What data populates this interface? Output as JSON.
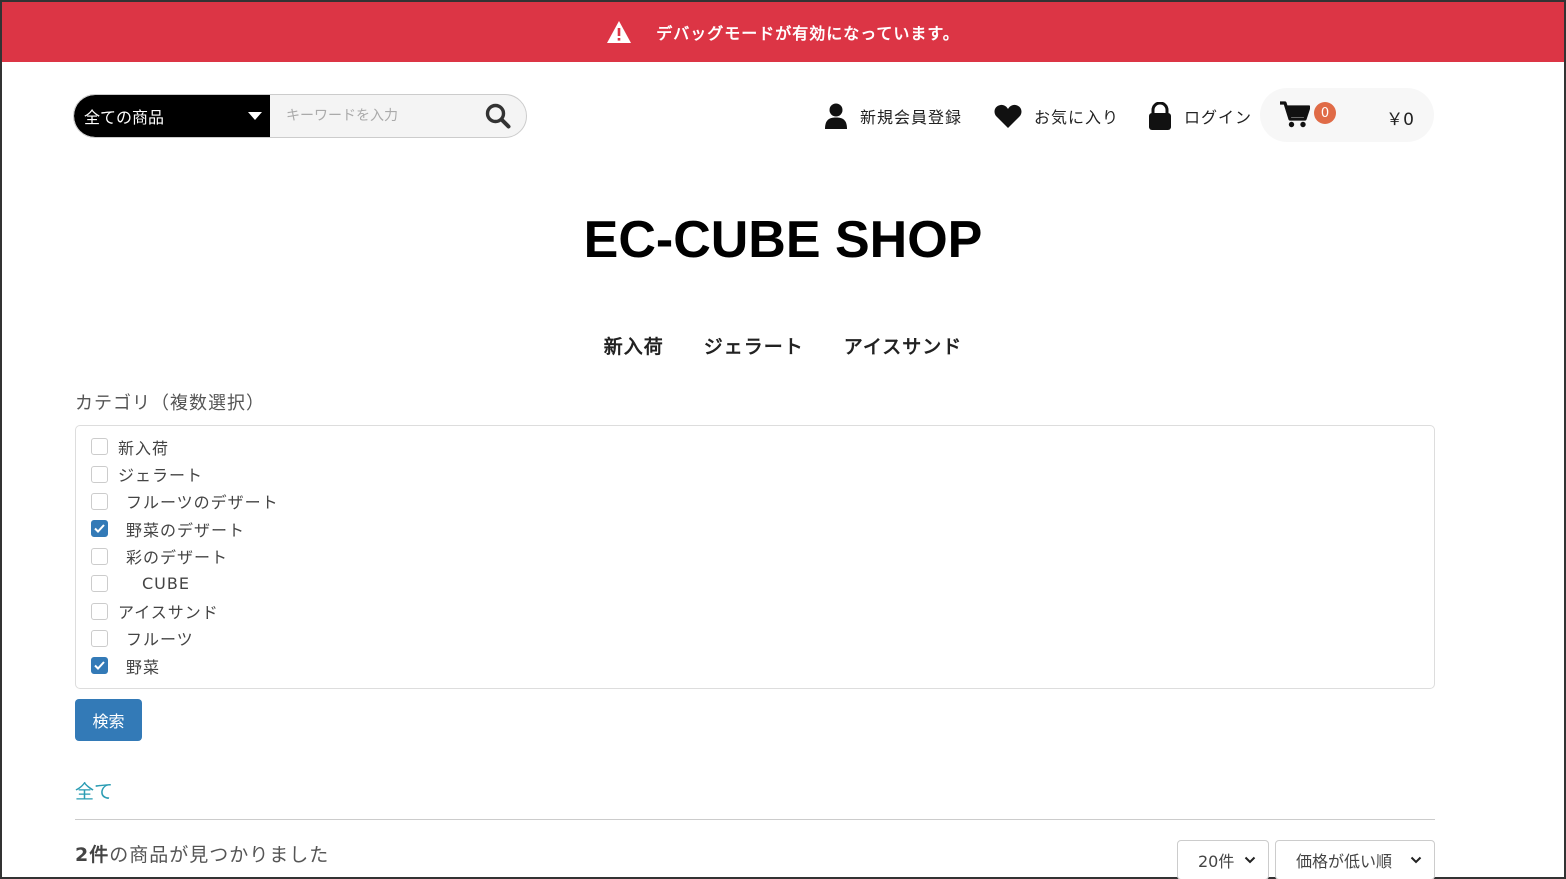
{
  "debug_banner": {
    "text": "デバッグモードが有効になっています。",
    "color": "#dc3545"
  },
  "search": {
    "category": "全ての商品",
    "placeholder": "キーワードを入力"
  },
  "header_nav": {
    "register": "新規会員登録",
    "favorites": "お気に入り",
    "login": "ログイン"
  },
  "cart": {
    "count": "0",
    "total": "￥0"
  },
  "shop_title": "EC-CUBE SHOP",
  "main_nav": [
    "新入荷",
    "ジェラート",
    "アイスサンド"
  ],
  "category_filter": {
    "label": "カテゴリ（複数選択）",
    "items": [
      {
        "label": "新入荷",
        "checked": false,
        "level": 0
      },
      {
        "label": "ジェラート",
        "checked": false,
        "level": 0
      },
      {
        "label": "フルーツのデザート",
        "checked": false,
        "level": 1
      },
      {
        "label": "野菜のデザート",
        "checked": true,
        "level": 1
      },
      {
        "label": "彩のデザート",
        "checked": false,
        "level": 1
      },
      {
        "label": "CUBE",
        "checked": false,
        "level": 2
      },
      {
        "label": "アイスサンド",
        "checked": false,
        "level": 0
      },
      {
        "label": "フルーツ",
        "checked": false,
        "level": 1
      },
      {
        "label": "野菜",
        "checked": true,
        "level": 1
      }
    ]
  },
  "search_button": "検索",
  "breadcrumb": "全て",
  "results": {
    "count": "2件",
    "text": "の商品が見つかりました"
  },
  "page_size": {
    "selected": "20件"
  },
  "sort": {
    "selected": "価格が低い順"
  }
}
